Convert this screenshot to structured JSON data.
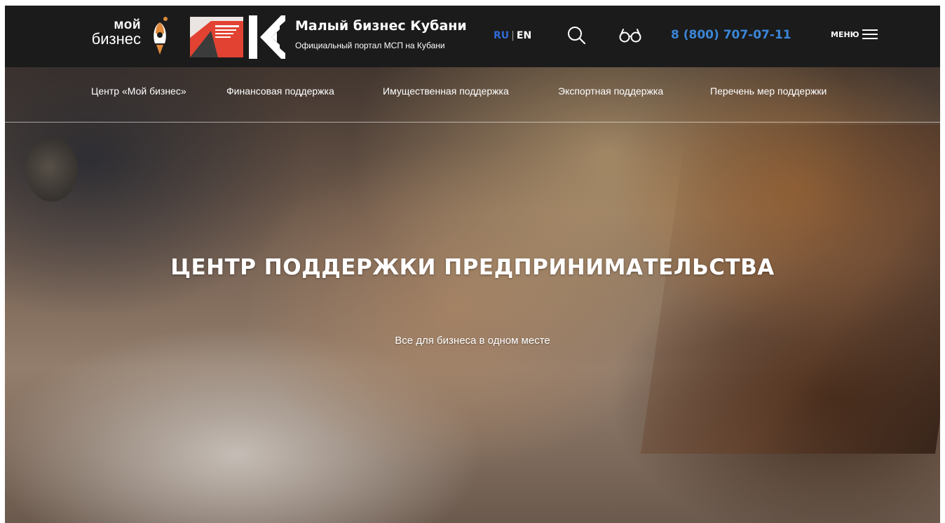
{
  "header": {
    "logo_moy_line1": "мой",
    "logo_moy_line2": "бизнес",
    "brand_title": "Малый бизнес Кубани",
    "brand_subtitle": "Официальный портал МСП на Кубани",
    "lang_ru": "RU",
    "lang_separator": "|",
    "lang_en": "EN",
    "phone": "8 (800) 707-07-11",
    "menu_label": "МЕНЮ",
    "icons": [
      "rocket-icon",
      "national-project-logo",
      "kuban-k-logo",
      "search-icon",
      "glasses-icon",
      "burger-icon"
    ]
  },
  "nav": {
    "items": [
      {
        "label": "Центр «Мой бизнес»"
      },
      {
        "label": "Финансовая поддержка"
      },
      {
        "label": "Имущественная поддержка"
      },
      {
        "label": "Экспортная поддержка"
      },
      {
        "label": "Перечень мер поддержки"
      }
    ]
  },
  "hero": {
    "title": "ЦЕНТР ПОДДЕРЖКИ ПРЕДПРИНИМАТЕЛЬСТВА",
    "subtitle": "Все для бизнеса в одном месте"
  },
  "colors": {
    "topbar_bg": "#1b1b1b",
    "phone": "#3a86d9",
    "lang_active": "#2f6bd8",
    "rocket_accent": "#e08a3c",
    "logo_red": "#e24232"
  }
}
